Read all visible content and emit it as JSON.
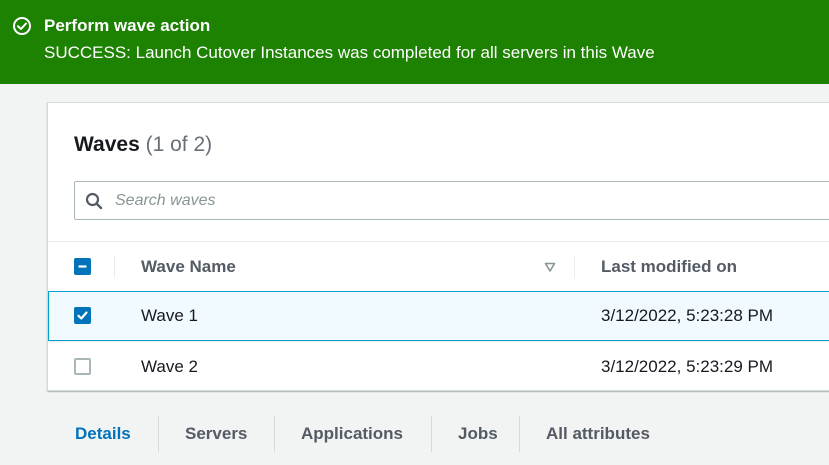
{
  "flash": {
    "title": "Perform wave action",
    "message": "SUCCESS: Launch Cutover Instances was completed for all servers in this Wave",
    "icon": "check-circle-icon",
    "color": "#1d8102"
  },
  "waves": {
    "title": "Waves",
    "count": "(1 of 2)",
    "search_placeholder": "Search waves",
    "columns": {
      "name": "Wave Name",
      "modified": "Last modified on"
    },
    "rows": [
      {
        "name": "Wave 1",
        "modified": "3/12/2022, 5:23:28 PM",
        "selected": true
      },
      {
        "name": "Wave 2",
        "modified": "3/12/2022, 5:23:29 PM",
        "selected": false
      }
    ]
  },
  "tabs": [
    {
      "label": "Details",
      "active": true
    },
    {
      "label": "Servers",
      "active": false
    },
    {
      "label": "Applications",
      "active": false
    },
    {
      "label": "Jobs",
      "active": false
    },
    {
      "label": "All attributes",
      "active": false
    }
  ],
  "colors": {
    "accent": "#0073bb",
    "success": "#1d8102"
  }
}
